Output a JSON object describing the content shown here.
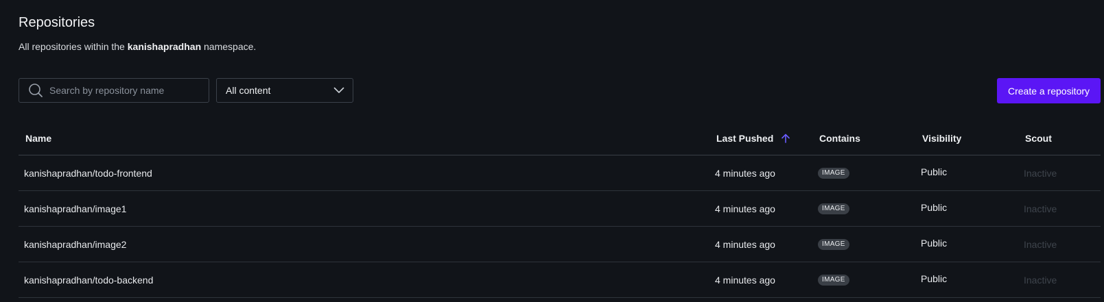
{
  "header": {
    "title": "Repositories",
    "subtitle_prefix": "All repositories within the",
    "namespace": "kanishapradhan",
    "subtitle_suffix": "namespace."
  },
  "search": {
    "placeholder": "Search by repository name",
    "value": ""
  },
  "filter": {
    "selected": "All content"
  },
  "actions": {
    "create_label": "Create a repository"
  },
  "colors": {
    "background": "#111419",
    "accent": "#5b16f5",
    "sort_arrow": "#6a5cff"
  },
  "table": {
    "columns": {
      "name": "Name",
      "last_pushed": "Last Pushed",
      "contains": "Contains",
      "visibility": "Visibility",
      "scout": "Scout"
    },
    "sort": {
      "column": "last_pushed",
      "direction": "ascending",
      "icon": "arrow-up-icon"
    },
    "rows": [
      {
        "name": "kanishapradhan/todo-frontend",
        "last_pushed": "4 minutes ago",
        "contains": "IMAGE",
        "visibility": "Public",
        "scout": "Inactive"
      },
      {
        "name": "kanishapradhan/image1",
        "last_pushed": "4 minutes ago",
        "contains": "IMAGE",
        "visibility": "Public",
        "scout": "Inactive"
      },
      {
        "name": "kanishapradhan/image2",
        "last_pushed": "4 minutes ago",
        "contains": "IMAGE",
        "visibility": "Public",
        "scout": "Inactive"
      },
      {
        "name": "kanishapradhan/todo-backend",
        "last_pushed": "4 minutes ago",
        "contains": "IMAGE",
        "visibility": "Public",
        "scout": "Inactive"
      }
    ]
  }
}
